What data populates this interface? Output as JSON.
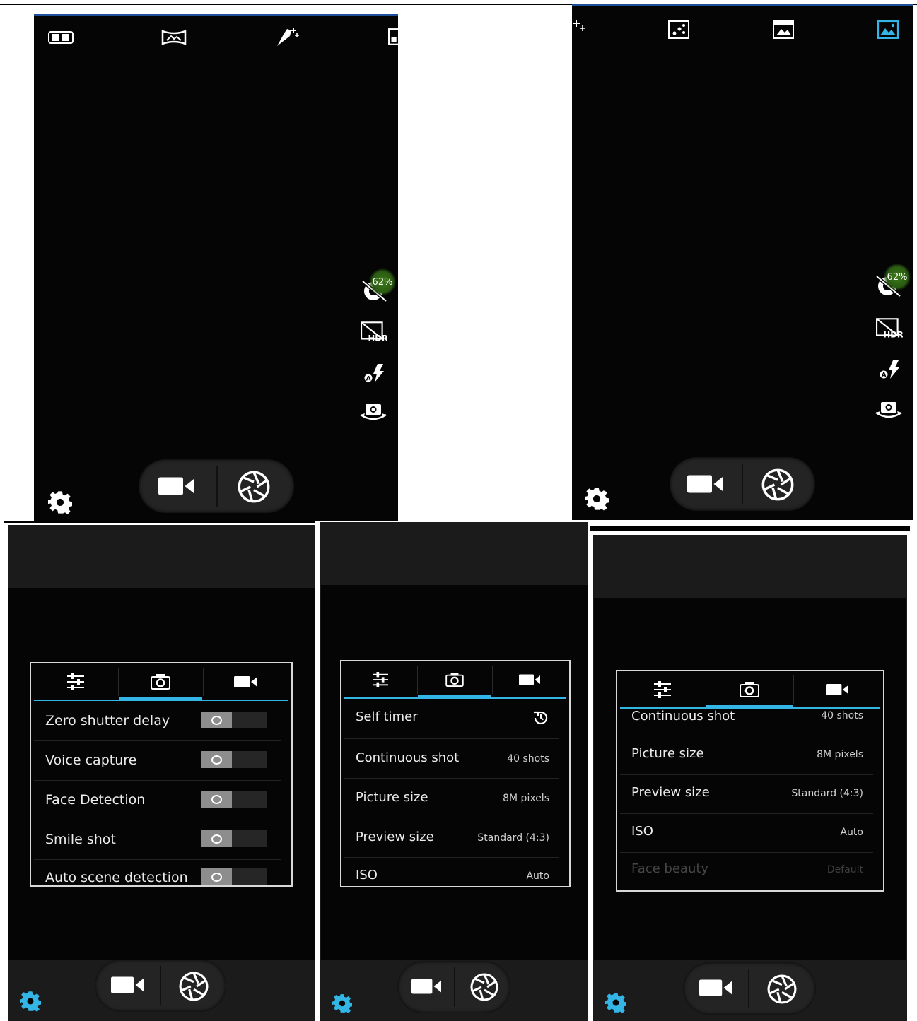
{
  "screens": {
    "s1": {
      "quota_badge": "62%"
    },
    "s2": {
      "quota_badge": "62%"
    }
  },
  "settings_a": {
    "rows": [
      {
        "label": "Zero shutter delay"
      },
      {
        "label": "Voice capture"
      },
      {
        "label": "Face Detection"
      },
      {
        "label": "Smile shot"
      },
      {
        "label": "Auto scene detection"
      }
    ]
  },
  "settings_b": {
    "rows": [
      {
        "label": "Self timer",
        "value": ""
      },
      {
        "label": "Continuous shot",
        "value": "40 shots"
      },
      {
        "label": "Picture size",
        "value": "8M pixels"
      },
      {
        "label": "Preview size",
        "value": "Standard (4:3)"
      },
      {
        "label": "ISO",
        "value": "Auto"
      }
    ]
  },
  "settings_c": {
    "rows": [
      {
        "label": "Continuous shot",
        "value": "40 shots"
      },
      {
        "label": "Picture size",
        "value": "8M pixels"
      },
      {
        "label": "Preview size",
        "value": "Standard (4:3)"
      },
      {
        "label": "ISO",
        "value": "Auto"
      },
      {
        "label": "Face beauty",
        "value": "Default"
      }
    ]
  },
  "icons": {
    "settings": "gear-icon",
    "video": "video-camera-icon",
    "shutter": "shutter-icon",
    "hdr": "hdr-icon",
    "flash": "flash-auto-icon",
    "switch_camera": "switch-camera-icon",
    "face_detect": "face-detect-off-icon",
    "tab_general": "sliders-icon",
    "tab_photo": "camera-icon",
    "tab_video": "video-icon",
    "self_timer": "timer-icon"
  },
  "colors": {
    "accent": "#33b5e5",
    "background": "#050505",
    "badge": "#3b7a19",
    "panel_gray": "#1b1b1b"
  }
}
